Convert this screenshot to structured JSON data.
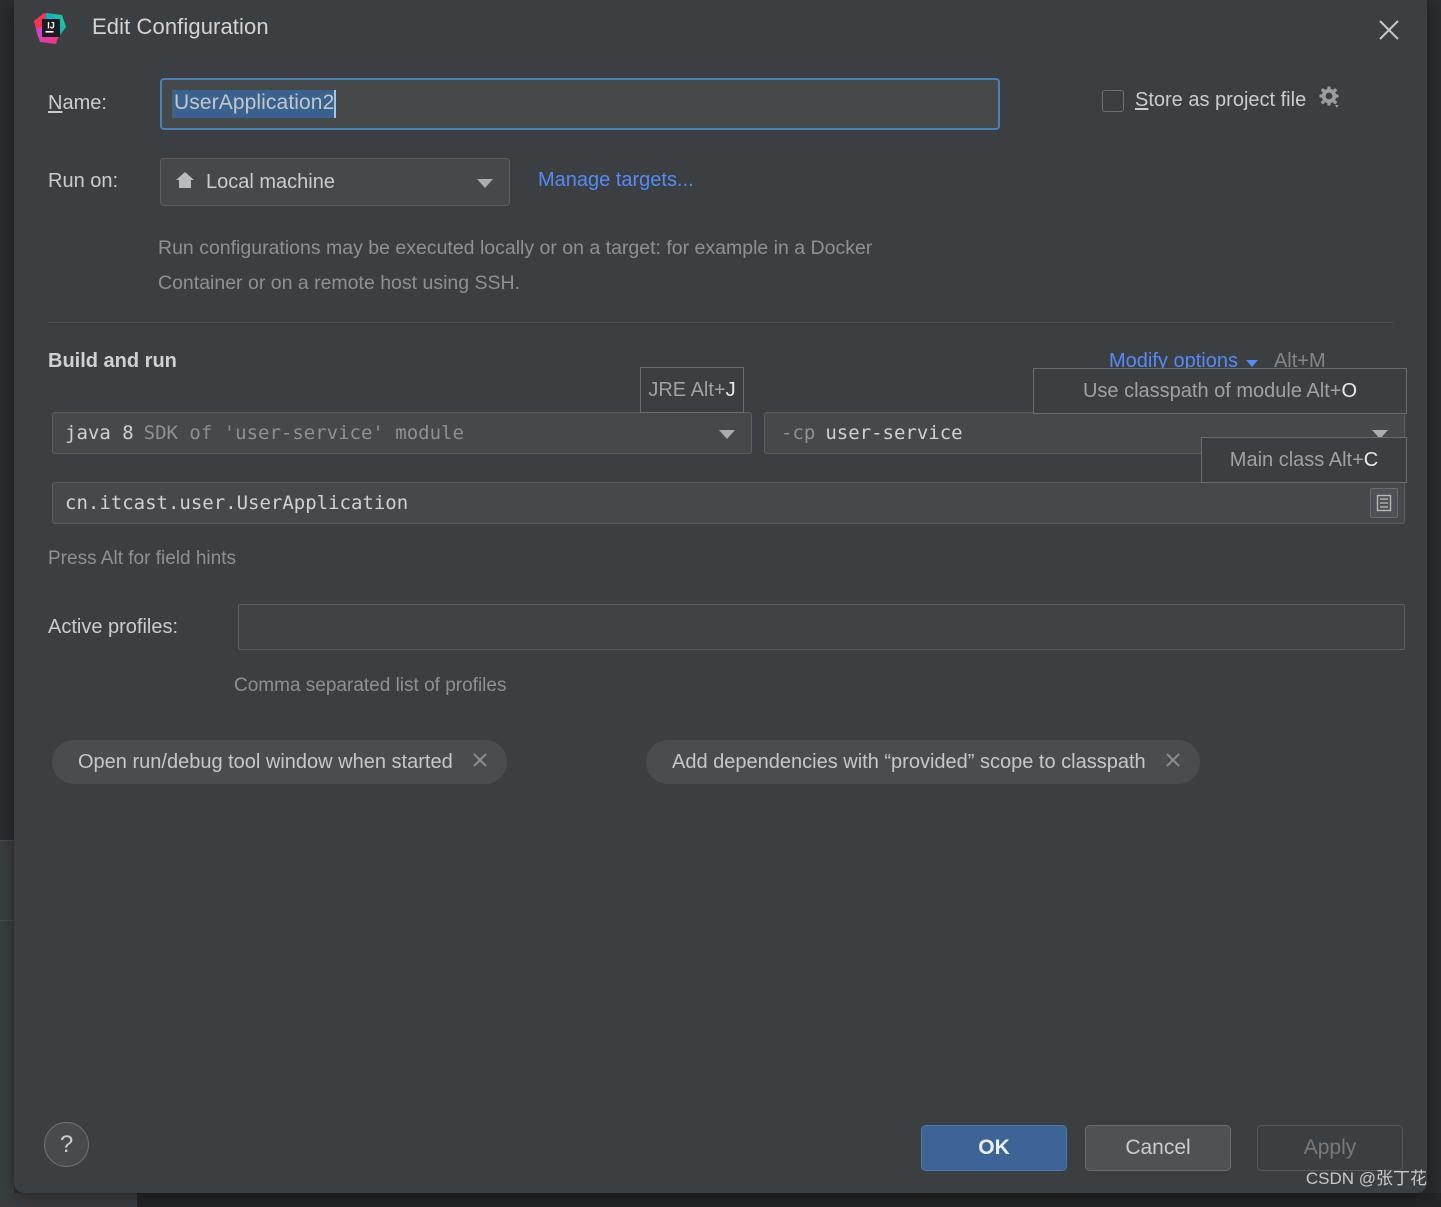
{
  "window": {
    "title": "Edit Configuration",
    "logo_icon": "intellij-idea-logo",
    "close_icon": "close-icon"
  },
  "name_row": {
    "label": "Name:",
    "value": "UserApplication2",
    "selected": true
  },
  "store_as_project_file": {
    "label": "Store as project file",
    "checked": false,
    "gear_icon": "gear-icon"
  },
  "run_on": {
    "label": "Run on:",
    "value": "Local machine",
    "value_icon": "home-icon",
    "dropdown_icon": "chevron-down-icon",
    "manage_targets_link": "Manage targets...",
    "hint": "Run configurations may be executed locally or on a target: for example in a Docker Container or on a remote host using SSH."
  },
  "build_and_run": {
    "title": "Build and run",
    "modify_options": {
      "label": "Modify options",
      "shortcut": "Alt+M",
      "chevron_icon": "chevron-down-icon"
    },
    "sdk": {
      "value_strong": "java 8",
      "value_dim": "SDK of 'user-service' module",
      "dropdown_icon": "chevron-down-icon"
    },
    "classpath": {
      "flag": "-cp",
      "value": "user-service",
      "dropdown_icon": "chevron-down-icon"
    },
    "main_class": {
      "value": "cn.itcast.user.UserApplication",
      "browse_icon": "list-browse-icon"
    },
    "press_alt_hint": "Press Alt for field hints",
    "field_hints": [
      {
        "text": "JRE Alt+",
        "key": "J"
      },
      {
        "text": "Use classpath of module Alt+",
        "key": "O"
      },
      {
        "text": "Main class Alt+",
        "key": "C"
      }
    ]
  },
  "active_profiles": {
    "label": "Active profiles:",
    "value": "",
    "hint": "Comma separated list of profiles"
  },
  "option_chips": [
    {
      "label": "Open run/debug tool window when started",
      "close_icon": "close-icon"
    },
    {
      "label": "Add dependencies with “provided” scope to classpath",
      "close_icon": "close-icon"
    }
  ],
  "footer": {
    "help_label": "?",
    "ok_label": "OK",
    "cancel_label": "Cancel",
    "apply_label": "Apply",
    "apply_enabled": false
  },
  "watermark": "CSDN @张丁花",
  "colors": {
    "dialog_bg": "#3c3f41",
    "field_bg": "#45494a",
    "accent_link": "#548af7",
    "focus_border": "#4c7fb8",
    "selection_bg": "#3a628f",
    "primary_button": "#3c6595"
  }
}
